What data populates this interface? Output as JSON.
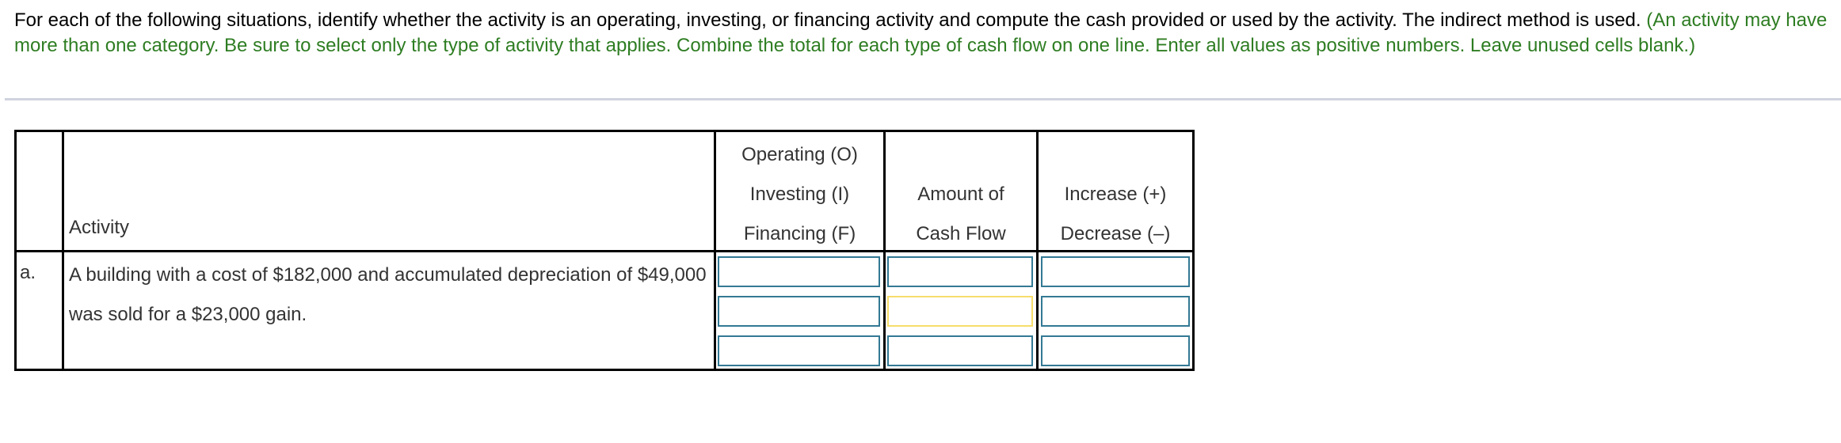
{
  "instructions": {
    "main": "For each of the following situations, identify whether the activity is an operating, investing, or financing activity and compute the cash provided or used by the activity. The indirect method is used. ",
    "note": "(An activity may have more than one category. Be sure to select only the type of activity that applies. Combine the total for each type of cash flow on one line. Enter all values as positive numbers. Leave unused cells blank.)"
  },
  "table": {
    "headers": {
      "activity": "Activity",
      "type": [
        "Operating (O)",
        "Investing (I)",
        "Financing (F)"
      ],
      "amount": [
        "Amount of",
        "Cash Flow"
      ],
      "direction": [
        "Increase (+)",
        "Decrease (–)"
      ]
    },
    "rows": [
      {
        "label": "a.",
        "text": "A building with a cost of $182,000 and accumulated depreciation of $49,000 was sold for a $23,000 gain.",
        "lines": [
          {
            "type": "",
            "amount": "",
            "direction": ""
          },
          {
            "type": "",
            "amount": "",
            "direction": ""
          },
          {
            "type": "",
            "amount": "",
            "direction": ""
          }
        ]
      }
    ]
  },
  "colors": {
    "note_green": "#2e7d22",
    "input_border": "#337994",
    "input_focus_border": "#f7dd6b"
  }
}
